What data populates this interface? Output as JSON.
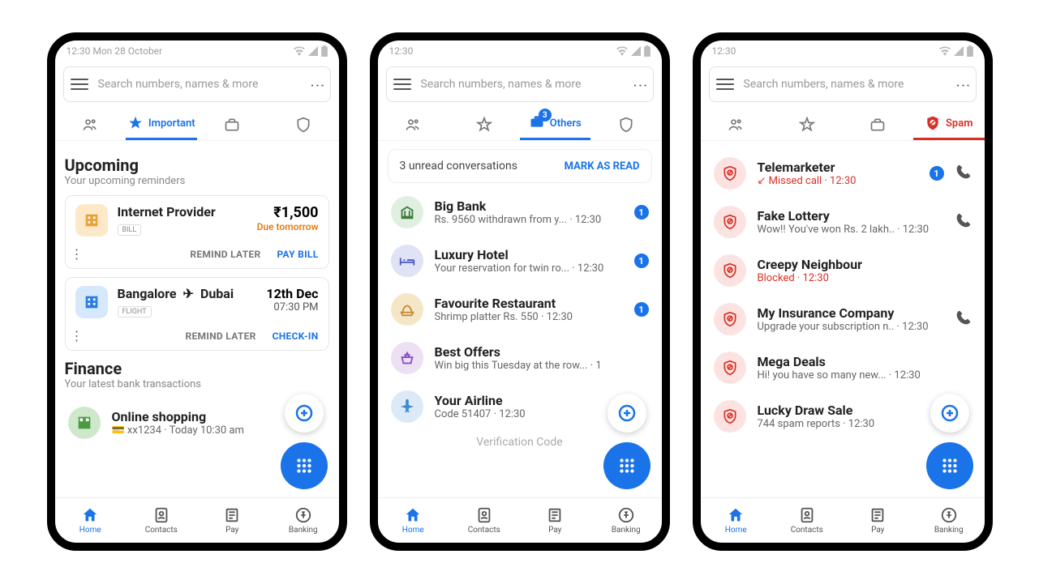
{
  "status": {
    "time_date": "12:30  Mon 28 October",
    "time": "12:30"
  },
  "search": {
    "placeholder": "Search numbers, names & more"
  },
  "tabs": {
    "important": "Important",
    "others": "Others",
    "spam": "Spam",
    "others_badge": "3"
  },
  "screen1": {
    "upcoming_title": "Upcoming",
    "upcoming_sub": "Your upcoming reminders",
    "card1": {
      "title": "Internet Provider",
      "tag": "BILL",
      "amount": "₹1,500",
      "due": "Due tomorrow",
      "remind": "REMIND LATER",
      "action": "PAY BILL"
    },
    "card2": {
      "from": "Bangalore",
      "to": "Dubai",
      "tag": "FLIGHT",
      "date": "12th Dec",
      "time": "07:30 PM",
      "remind": "REMIND LATER",
      "action": "CHECK-IN"
    },
    "finance_title": "Finance",
    "finance_sub": "Your latest bank transactions",
    "txn": {
      "title": "Online shopping",
      "sub": "xx1234 · Today 10:30 am"
    }
  },
  "screen2": {
    "banner_text": "3 unread conversations",
    "banner_action": "MARK AS READ",
    "rows": [
      {
        "title": "Big Bank",
        "sub": "Rs. 9560 withdrawn from y... · 12:30",
        "badge": "1",
        "color": "#e1efe2",
        "icon": "bank"
      },
      {
        "title": "Luxury Hotel",
        "sub": "Your reservation for twin ro... · 12:30",
        "badge": "1",
        "color": "#dfe3f5",
        "icon": "bed"
      },
      {
        "title": "Favourite Restaurant",
        "sub": "Shrimp platter Rs. 550 · 12:30",
        "badge": "1",
        "color": "#f6e6c8",
        "icon": "food"
      },
      {
        "title": "Best Offers",
        "sub": "Win big this Tuesday at the row... · 1",
        "badge": "",
        "color": "#ece0f3",
        "icon": "basket"
      },
      {
        "title": "Your Airline",
        "sub": "Code 51407 · 12:30",
        "badge": "",
        "color": "#dceaf7",
        "icon": "plane"
      }
    ],
    "cutoff": "Verification Code"
  },
  "screen3": {
    "rows": [
      {
        "title": "Telemarketer",
        "sub": "Missed call · 12:30",
        "red": true,
        "badge": "1",
        "phone": true,
        "missed": true
      },
      {
        "title": "Fake Lottery",
        "sub": "Wow!! You've won Rs. 2 lakh.. · 12:30",
        "phone": true
      },
      {
        "title": "Creepy Neighbour",
        "sub": "Blocked · 12:30",
        "red": true
      },
      {
        "title": "My Insurance Company",
        "sub": "Upgrade your subscription n.. · 12:30",
        "phone": true
      },
      {
        "title": "Mega Deals",
        "sub": "Hi! you have so many new... · 12:30"
      },
      {
        "title": "Lucky Draw Sale",
        "sub": "744 spam reports · 12:30"
      }
    ]
  },
  "nav": {
    "home": "Home",
    "contacts": "Contacts",
    "pay": "Pay",
    "banking": "Banking"
  }
}
